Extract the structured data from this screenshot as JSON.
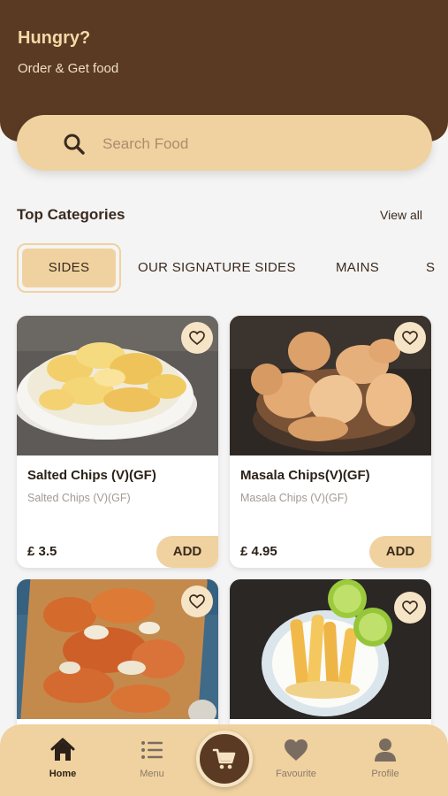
{
  "header": {
    "title": "Hungry?",
    "subtitle": "Order & Get food"
  },
  "search": {
    "placeholder": "Search Food"
  },
  "categories": {
    "title": "Top Categories",
    "view_all": "View all",
    "tabs": [
      {
        "label": "SIDES",
        "active": true
      },
      {
        "label": "OUR SIGNATURE SIDES"
      },
      {
        "label": "MAINS"
      },
      {
        "label": "S"
      }
    ]
  },
  "products": [
    {
      "name": "Salted Chips (V)(GF)",
      "desc": "Salted Chips (V)(GF)",
      "price": "£ 3.5",
      "add": "ADD"
    },
    {
      "name": "Masala Chips(V)(GF)",
      "desc": "Masala Chips (V)(GF)",
      "price": "£ 4.95",
      "add": "ADD"
    },
    {
      "name": "",
      "desc": "",
      "price": "",
      "add": ""
    },
    {
      "name": "",
      "desc": "",
      "price": "",
      "add": ""
    }
  ],
  "nav": {
    "items": [
      {
        "label": "Home",
        "icon": "home-icon",
        "active": true
      },
      {
        "label": "Menu",
        "icon": "menu-icon"
      },
      {
        "label": "Favourite",
        "icon": "heart-icon"
      },
      {
        "label": "Profile",
        "icon": "profile-icon"
      }
    ],
    "cart_icon": "cart-icon"
  },
  "colors": {
    "header_bg": "#5a3a22",
    "accent": "#f0d2a0",
    "background": "#f5f4f4"
  }
}
